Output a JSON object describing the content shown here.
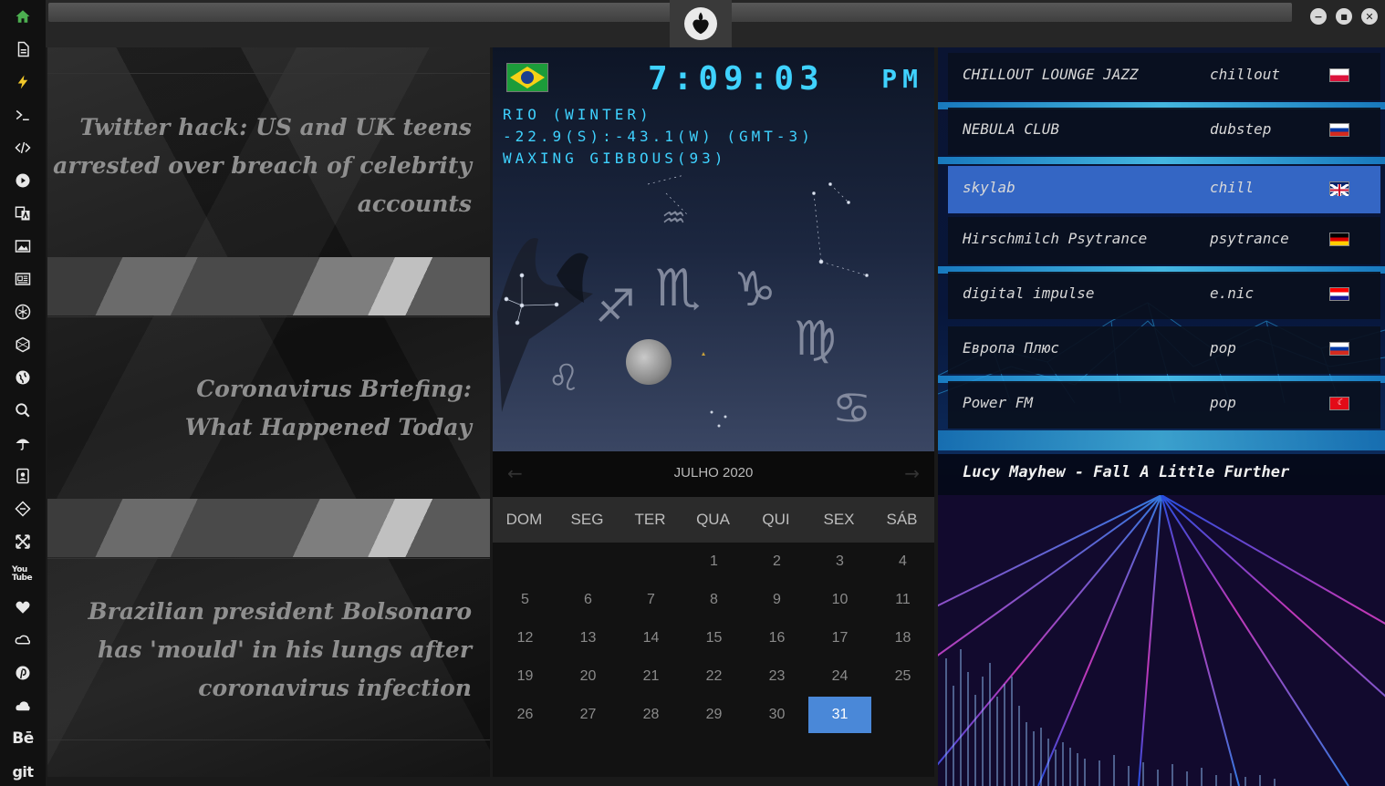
{
  "sidebar": {
    "items": [
      "home-icon",
      "document-icon",
      "lightning-icon",
      "terminal-icon",
      "code-icon",
      "play-icon",
      "translate-icon",
      "image-icon",
      "newspaper-icon",
      "rebel-alliance-icon",
      "hexagon-icon",
      "globe-icon",
      "search-icon",
      "umbrella-icon",
      "contact-icon",
      "git-diff-icon",
      "expand-icon",
      "youtube-icon",
      "heart-icon",
      "cloud-link-icon",
      "pinterest-icon",
      "cloud-icon",
      "behance-icon",
      "git-icon"
    ],
    "youtube_label": "You Tube",
    "behance_label": "Bē",
    "git_label": "git"
  },
  "window": {
    "minimize_symbol": "−",
    "maximize_symbol": "■",
    "close_symbol": "✕"
  },
  "news": {
    "items": [
      "Twitter hack: US and UK teens arrested over breach of celebrity accounts",
      "Coronavirus Briefing: What Happened Today",
      "Brazilian president Bolsonaro has 'mould' in his lungs after coronavirus infection"
    ]
  },
  "clock": {
    "time": "7:09:03",
    "ampm": "PM",
    "location": "RIO (WINTER)",
    "coordinates": "-22.9(S):-43.1(W) (GMT-3)",
    "moon_phase": "WAXING GIBBOUS(93)",
    "zodiac_glyphs": [
      "♐",
      "♏",
      "♑",
      "♍",
      "♋",
      "♌",
      "♒"
    ]
  },
  "calendar": {
    "title": "JULHO 2020",
    "prev_arrow": "←",
    "next_arrow": "→",
    "day_names": [
      "DOM",
      "SEG",
      "TER",
      "QUA",
      "QUI",
      "SEX",
      "SÁB"
    ],
    "weeks": [
      [
        "",
        "",
        "",
        "1",
        "2",
        "3",
        "4"
      ],
      [
        "5",
        "6",
        "7",
        "8",
        "9",
        "10",
        "11"
      ],
      [
        "12",
        "13",
        "14",
        "15",
        "16",
        "17",
        "18"
      ],
      [
        "19",
        "20",
        "21",
        "22",
        "23",
        "24",
        "25"
      ],
      [
        "26",
        "27",
        "28",
        "29",
        "30",
        "31",
        ""
      ]
    ],
    "today": "31",
    "today_color": "#4a88d8"
  },
  "radio": {
    "stations": [
      {
        "name": "CHILLOUT LOUNGE JAZZ",
        "genre": "chillout",
        "flag": "poland"
      },
      {
        "name": "NEBULA CLUB",
        "genre": "dubstep",
        "flag": "russia"
      },
      {
        "name": "skylab",
        "genre": "chill",
        "flag": "uk"
      },
      {
        "name": "Hirschmilch Psytrance",
        "genre": "psytrance",
        "flag": "germany"
      },
      {
        "name": "digital impulse",
        "genre": "e.nic",
        "flag": "croatia"
      },
      {
        "name": "Европа Плюс",
        "genre": "pop",
        "flag": "russia"
      },
      {
        "name": "Power FM",
        "genre": "pop",
        "flag": "turkey"
      }
    ],
    "selected_index": 2,
    "selected_color": "#3466c4",
    "now_playing": "Lucy Mayhew - Fall A Little Further"
  },
  "colors": {
    "accent_cyan": "#3fd2ff",
    "home_green": "#4caf50",
    "lightning_yellow": "#f2c82a"
  }
}
